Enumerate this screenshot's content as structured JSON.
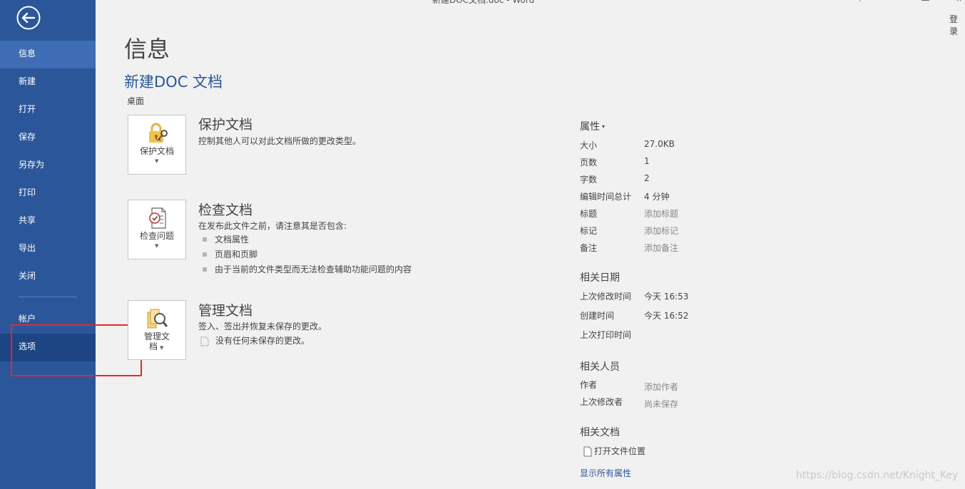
{
  "window": {
    "title": "新建DOC文档.doc - Word",
    "login": "登录"
  },
  "sidebar": {
    "items": [
      {
        "label": "信息"
      },
      {
        "label": "新建"
      },
      {
        "label": "打开"
      },
      {
        "label": "保存"
      },
      {
        "label": "另存为"
      },
      {
        "label": "打印"
      },
      {
        "label": "共享"
      },
      {
        "label": "导出"
      },
      {
        "label": "关闭"
      }
    ],
    "bottom_items": [
      {
        "label": "帐户"
      },
      {
        "label": "选项"
      }
    ]
  },
  "page": {
    "title": "信息",
    "doc_name": "新建DOC 文档",
    "location": "桌面"
  },
  "sections": {
    "protect": {
      "button_label": "保护文档",
      "title": "保护文档",
      "desc": "控制其他人可以对此文档所做的更改类型。"
    },
    "inspect": {
      "button_label": "检查问题",
      "title": "检查文档",
      "desc": "在发布此文件之前，请注意其是否包含:",
      "bullets": [
        "文档属性",
        "页眉和页脚",
        "由于当前的文件类型而无法检查辅助功能问题的内容"
      ]
    },
    "manage": {
      "button_label_line1": "管理文",
      "button_label_line2": "档",
      "title": "管理文档",
      "desc": "签入、签出并恢复未保存的更改。",
      "note": "没有任何未保存的更改。"
    }
  },
  "properties": {
    "header": "属性",
    "size": {
      "label": "大小",
      "value": "27.0KB"
    },
    "pages": {
      "label": "页数",
      "value": "1"
    },
    "words": {
      "label": "字数",
      "value": "2"
    },
    "edit_time": {
      "label": "编辑时间总计",
      "value": "4 分钟"
    },
    "title": {
      "label": "标题",
      "value": "添加标题"
    },
    "tags": {
      "label": "标记",
      "value": "添加标记"
    },
    "comments": {
      "label": "备注",
      "value": "添加备注"
    }
  },
  "dates": {
    "header": "相关日期",
    "modified": {
      "label": "上次修改时间",
      "value": "今天 16:53"
    },
    "created": {
      "label": "创建时间",
      "value": "今天 16:52"
    },
    "printed": {
      "label": "上次打印时间",
      "value": ""
    }
  },
  "people": {
    "header": "相关人员",
    "author": {
      "label": "作者",
      "value": "添加作者"
    },
    "last_modified_by": {
      "label": "上次修改者",
      "value": "尚未保存"
    }
  },
  "related_docs": {
    "header": "相关文档",
    "open_location": "打开文件位置",
    "show_all": "显示所有属性"
  },
  "watermark": "https://blog.csdn.net/Knight_Key",
  "colors": {
    "sidebar": "#2b579a",
    "accent": "#2b579a",
    "highlight_box": "#e8272a"
  }
}
